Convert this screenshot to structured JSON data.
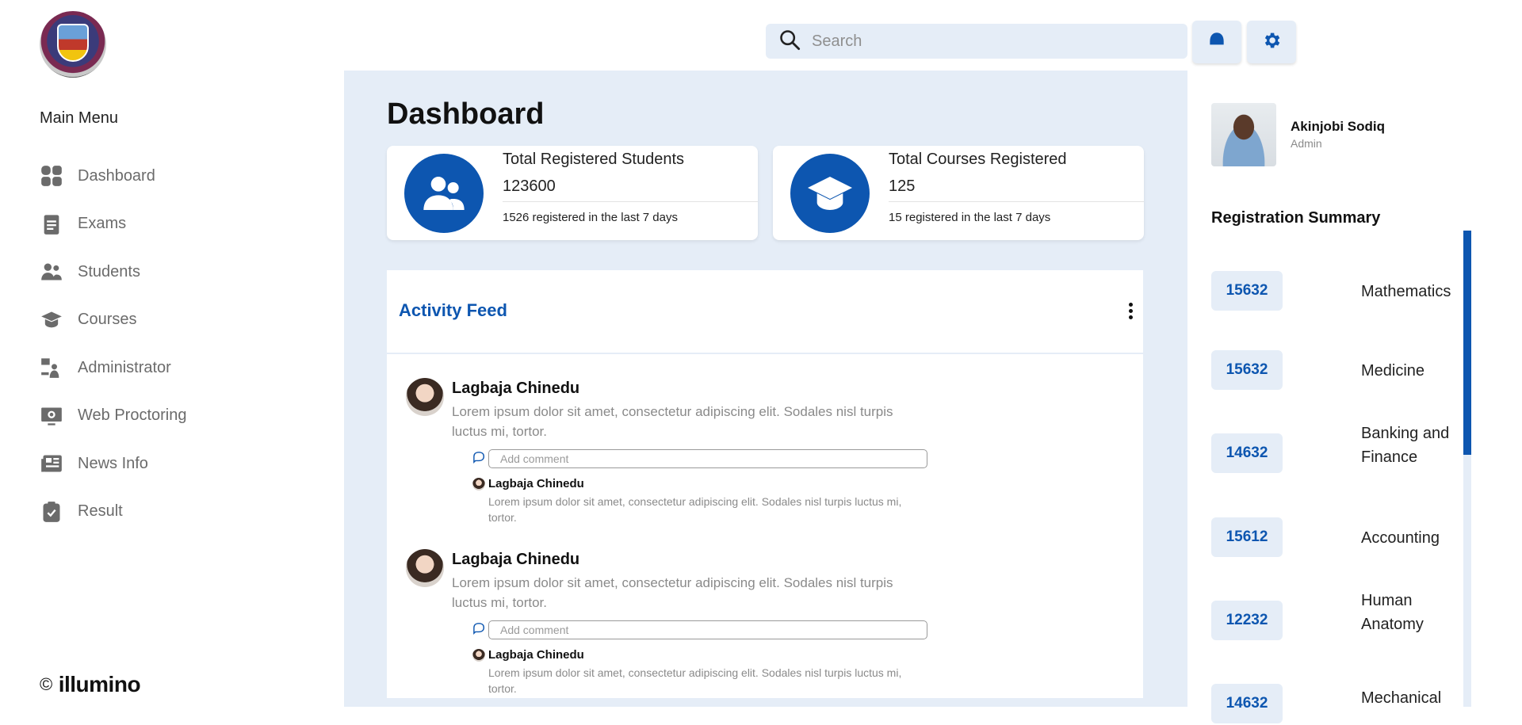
{
  "search": {
    "placeholder": "Search"
  },
  "sidebar": {
    "menu_title": "Main Menu",
    "items": [
      {
        "label": "Dashboard",
        "icon": "dashboard-icon"
      },
      {
        "label": "Exams",
        "icon": "exams-icon"
      },
      {
        "label": "Students",
        "icon": "students-icon"
      },
      {
        "label": "Courses",
        "icon": "courses-icon"
      },
      {
        "label": "Administrator",
        "icon": "administrator-icon"
      },
      {
        "label": "Web Proctoring",
        "icon": "web-proctoring-icon"
      },
      {
        "label": "News Info",
        "icon": "news-icon"
      },
      {
        "label": "Result",
        "icon": "result-icon"
      }
    ],
    "brand": {
      "copyright": "©",
      "name": "illumino"
    }
  },
  "main": {
    "title": "Dashboard",
    "stats": [
      {
        "label": "Total Registered Students",
        "value": "123600",
        "sub": "1526 registered in the last 7 days",
        "icon": "students-icon"
      },
      {
        "label": "Total Courses Registered",
        "value": "125",
        "sub": "15 registered in the last 7 days",
        "icon": "graduation-cap-icon"
      }
    ],
    "feed": {
      "title": "Activity Feed",
      "posts": [
        {
          "name": "Lagbaja Chinedu",
          "text": "Lorem ipsum dolor sit amet, consectetur adipiscing elit. Sodales nisl turpis luctus mi, tortor.",
          "comment_placeholder": "Add comment",
          "reply": {
            "name": "Lagbaja Chinedu",
            "text": "Lorem ipsum dolor sit amet, consectetur adipiscing elit. Sodales nisl turpis luctus mi, tortor."
          }
        },
        {
          "name": "Lagbaja Chinedu",
          "text": "Lorem ipsum dolor sit amet, consectetur adipiscing elit. Sodales nisl turpis luctus mi, tortor.",
          "comment_placeholder": "Add comment",
          "reply": {
            "name": "Lagbaja Chinedu",
            "text": "Lorem ipsum dolor sit amet, consectetur adipiscing elit. Sodales nisl turpis luctus mi, tortor."
          }
        }
      ]
    }
  },
  "profile": {
    "name": "Akinjobi Sodiq",
    "role": "Admin"
  },
  "registration_summary": {
    "title": "Registration Summary",
    "items": [
      {
        "count": "15632",
        "course": "Mathematics"
      },
      {
        "count": "15632",
        "course": "Medicine"
      },
      {
        "count": "14632",
        "course": "Banking and Finance"
      },
      {
        "count": "15612",
        "course": "Accounting"
      },
      {
        "count": "12232",
        "course": "Human Anatomy"
      },
      {
        "count": "14632",
        "course": "Mechanical"
      }
    ]
  },
  "colors": {
    "accent": "#0d56b0",
    "panel_bg": "#e5edf7",
    "muted_text": "#8a8a8a"
  }
}
